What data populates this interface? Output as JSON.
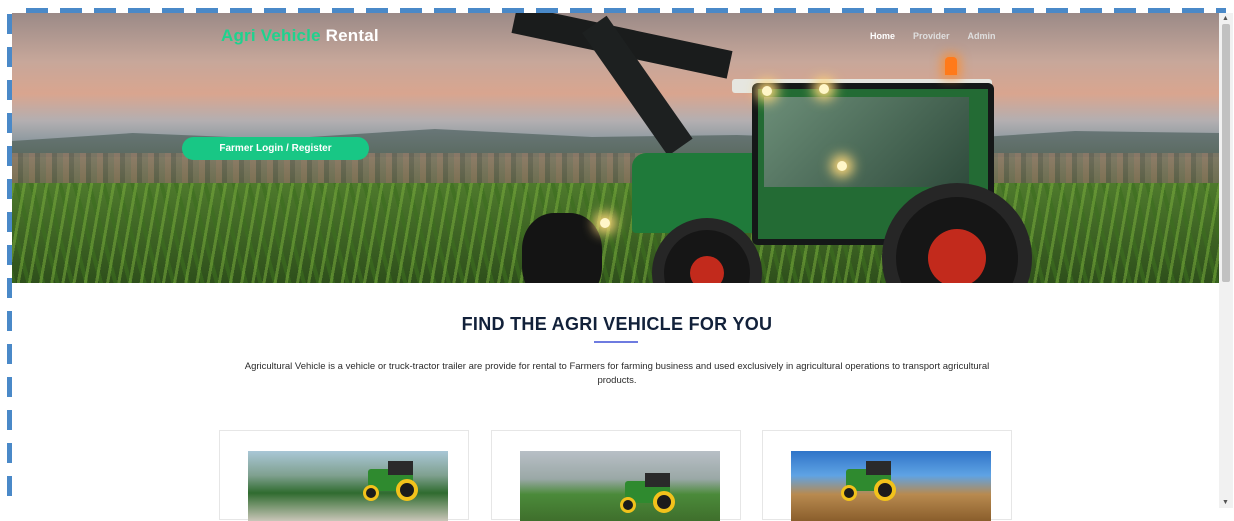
{
  "header": {
    "brand_part1": "Agri Vehicle",
    "brand_part2": "Rental",
    "nav": [
      {
        "label": "Home",
        "active": true
      },
      {
        "label": "Provider",
        "active": false
      },
      {
        "label": "Admin",
        "active": false
      }
    ]
  },
  "hero": {
    "cta_label": "Farmer Login / Register",
    "cta_color": "#18c785",
    "brand_accent": "#1fd28e"
  },
  "main": {
    "title": "FIND THE AGRI VEHICLE FOR YOU",
    "description": "Agricultural Vehicle is a vehicle or truck-tractor trailer are provide for rental to Farmers for farming business and used exclusively in agricultural operations to transport agricultural products.",
    "cards": [
      {
        "image": "tractor-with-loader-photo"
      },
      {
        "image": "tractor-in-field-photo"
      },
      {
        "image": "tractor-harvest-field-photo"
      }
    ]
  },
  "icons": {
    "scroll_up": "scroll-up-arrow-icon",
    "scroll_down": "scroll-down-arrow-icon"
  }
}
